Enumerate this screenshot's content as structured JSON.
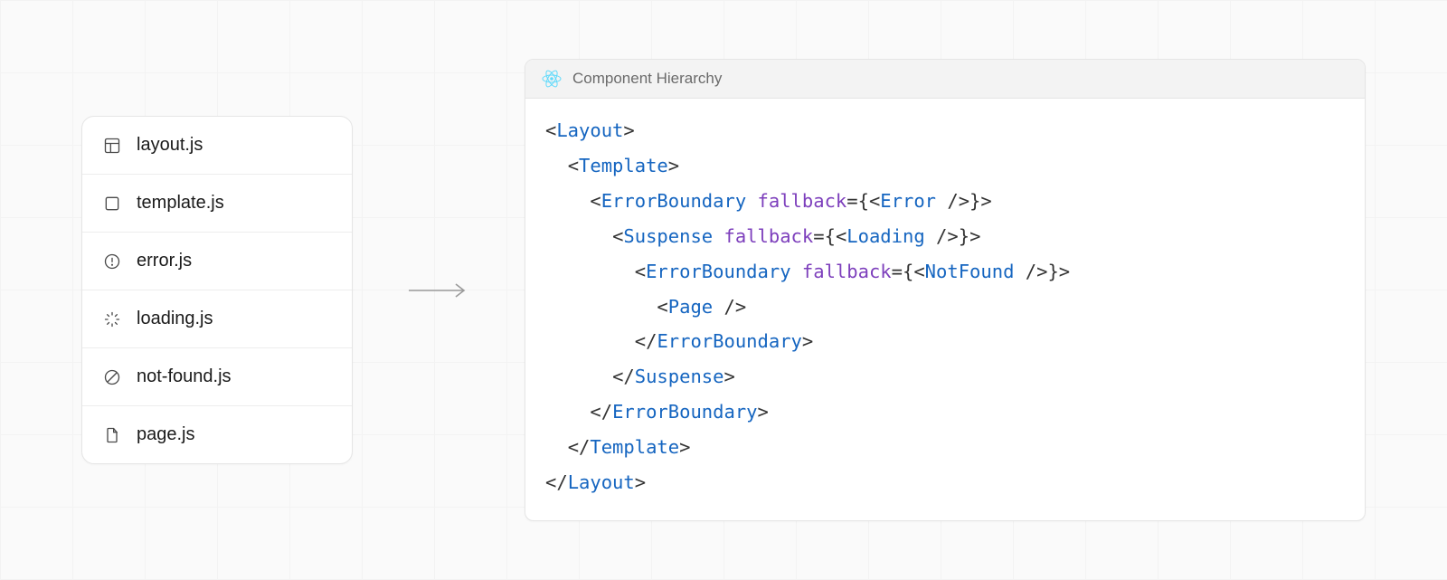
{
  "files": {
    "layout": {
      "label": "layout.js",
      "icon": "layout-icon"
    },
    "template": {
      "label": "template.js",
      "icon": "template-icon"
    },
    "error": {
      "label": "error.js",
      "icon": "error-icon"
    },
    "loading": {
      "label": "loading.js",
      "icon": "loading-icon"
    },
    "notfound": {
      "label": "not-found.js",
      "icon": "notfound-icon"
    },
    "page": {
      "label": "page.js",
      "icon": "page-icon"
    }
  },
  "code_panel": {
    "title": "Component Hierarchy"
  },
  "component_hierarchy": {
    "tokens": {
      "layout_open_lt": "<",
      "layout_open_name": "Layout",
      "layout_open_gt": ">",
      "template_open_lt": "<",
      "template_open_name": "Template",
      "template_open_gt": ">",
      "eb1_open_lt": "<",
      "eb1_open_name": "ErrorBoundary",
      "eb1_space": " ",
      "eb1_attr": "fallback",
      "eb1_eq": "=",
      "eb1_lb": "{",
      "eb1_inner_lt": "<",
      "eb1_inner_name": "Error",
      "eb1_inner_slashgt": " />",
      "eb1_rb": "}",
      "eb1_open_gt": ">",
      "susp_open_lt": "<",
      "susp_open_name": "Suspense",
      "susp_space": " ",
      "susp_attr": "fallback",
      "susp_eq": "=",
      "susp_lb": "{",
      "susp_inner_lt": "<",
      "susp_inner_name": "Loading",
      "susp_inner_slashgt": " />",
      "susp_rb": "}",
      "susp_open_gt": ">",
      "eb2_open_lt": "<",
      "eb2_open_name": "ErrorBoundary",
      "eb2_space": " ",
      "eb2_attr": "fallback",
      "eb2_eq": "=",
      "eb2_lb": "{",
      "eb2_inner_lt": "<",
      "eb2_inner_name": "NotFound",
      "eb2_inner_slashgt": " />",
      "eb2_rb": "}",
      "eb2_open_gt": ">",
      "page_lt": "<",
      "page_name": "Page",
      "page_slashgt": " />",
      "eb2_close_lt": "</",
      "eb2_close_name": "ErrorBoundary",
      "eb2_close_gt": ">",
      "susp_close_lt": "</",
      "susp_close_name": "Suspense",
      "susp_close_gt": ">",
      "eb1_close_lt": "</",
      "eb1_close_name": "ErrorBoundary",
      "eb1_close_gt": ">",
      "template_close_lt": "</",
      "template_close_name": "Template",
      "template_close_gt": ">",
      "layout_close_lt": "</",
      "layout_close_name": "Layout",
      "layout_close_gt": ">"
    },
    "indent": {
      "i0": "",
      "i1": "  ",
      "i2": "    ",
      "i3": "      ",
      "i4": "        ",
      "i5": "          "
    }
  }
}
